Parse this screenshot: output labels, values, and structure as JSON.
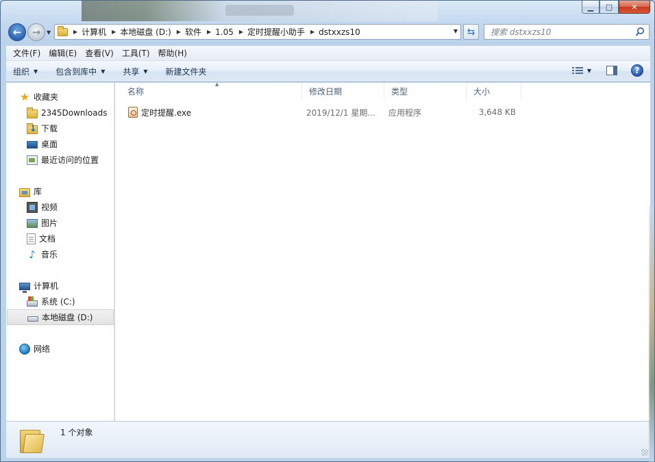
{
  "window": {
    "caption_buttons": {
      "minimize": "▁",
      "maximize": "□",
      "close": "✕"
    }
  },
  "address": {
    "crumbs": [
      "计算机",
      "本地磁盘 (D:)",
      "软件",
      "1.05",
      "定时提醒小助手",
      "dstxxzs10"
    ],
    "search_placeholder": "搜索 dstxxzs10"
  },
  "menu": [
    "文件(F)",
    "编辑(E)",
    "查看(V)",
    "工具(T)",
    "帮助(H)"
  ],
  "commands": {
    "organize": "组织",
    "include_in_library": "包含到库中",
    "share": "共享",
    "new_folder": "新建文件夹"
  },
  "nav": {
    "favorites": {
      "label": "收藏夹",
      "items": [
        "2345Downloads",
        "下载",
        "桌面",
        "最近访问的位置"
      ]
    },
    "libraries": {
      "label": "库",
      "items": [
        "视频",
        "图片",
        "文档",
        "音乐"
      ]
    },
    "computer": {
      "label": "计算机",
      "items": [
        "系统 (C:)",
        "本地磁盘 (D:)"
      ],
      "selected": "本地磁盘 (D:)"
    },
    "network": {
      "label": "网络"
    }
  },
  "columns": [
    "名称",
    "修改日期",
    "类型",
    "大小"
  ],
  "files": [
    {
      "name": "定时提醒.exe",
      "modified": "2019/12/1 星期...",
      "type": "应用程序",
      "size": "3,648 KB"
    }
  ],
  "status": {
    "count_text": "1 个对象"
  },
  "colors": {
    "frame": "#c5d9ef",
    "command_bar": "#dde8f4",
    "accent_blue": "#2c63b5",
    "folder_yellow": "#dcb13f"
  }
}
